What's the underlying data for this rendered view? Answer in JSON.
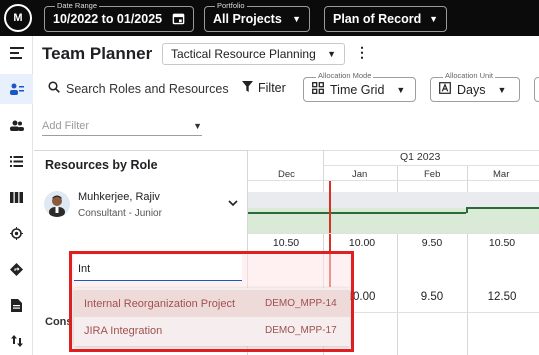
{
  "topbar": {
    "date_range": {
      "caption": "Date Range",
      "value": "10/2022 to 01/2025"
    },
    "portfolio": {
      "caption": "Portfolio",
      "value": "All Projects"
    },
    "plan": {
      "value": "Plan of Record"
    }
  },
  "header": {
    "title": "Team Planner",
    "view": "Tactical Resource Planning"
  },
  "toolbar": {
    "search_label": "Search Roles and Resources",
    "filter_label": "Filter",
    "allocation_mode": {
      "caption": "Allocation Mode",
      "value": "Time Grid"
    },
    "allocation_unit": {
      "caption": "Allocation Unit",
      "value": "Days"
    }
  },
  "add_filter": {
    "placeholder": "Add Filter"
  },
  "grid": {
    "left_header": "Resources by Role",
    "quarter": "Q1 2023",
    "months": [
      "Dec",
      "Jan",
      "Feb",
      "Mar"
    ],
    "resource": {
      "name": "Muhkerjee, Rajiv",
      "role": "Consultant - Junior"
    },
    "row1_values": [
      "10.50",
      "10.00",
      "9.50",
      "10.50"
    ],
    "row2_values": [
      "10.00",
      "9.50",
      "12.50"
    ],
    "next_group_partial": "Cons"
  },
  "dropdown": {
    "typed_value": "Int",
    "options": [
      {
        "name": "Internal Reorganization Project",
        "code": "DEMO_MPP-14"
      },
      {
        "name": "JIRA Integration",
        "code": "DEMO_MPP-17"
      }
    ]
  },
  "colors": {
    "topbar": "#0b0b0b",
    "accent": "#1a56c8",
    "highlight": "#e02020",
    "allocation_fill": "#d9ead6"
  }
}
